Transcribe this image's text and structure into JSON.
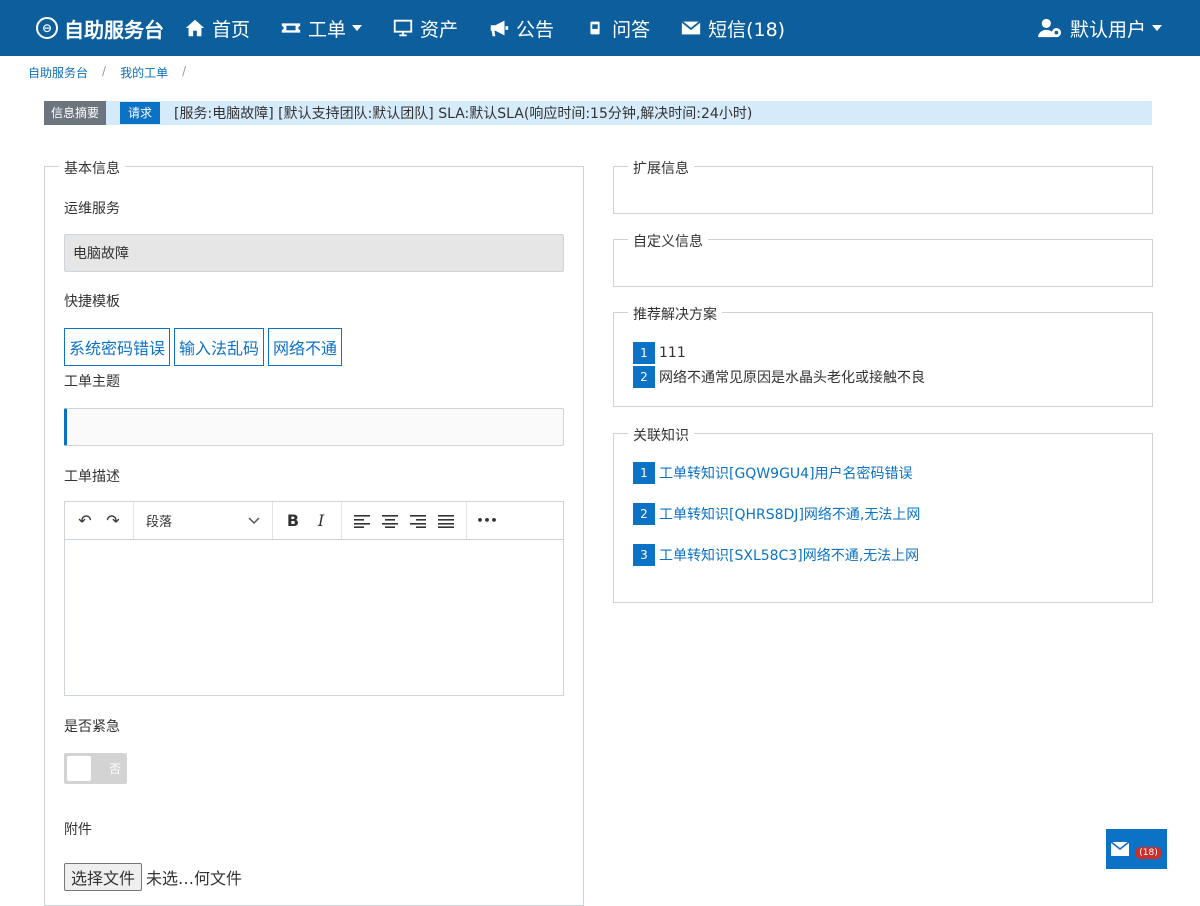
{
  "nav": {
    "brand": "自助服务台",
    "items": [
      {
        "label": "首页",
        "icon": "home-icon"
      },
      {
        "label": "工单",
        "icon": "ticket-icon",
        "dropdown": true
      },
      {
        "label": "资产",
        "icon": "monitor-icon"
      },
      {
        "label": "公告",
        "icon": "megaphone-icon"
      },
      {
        "label": "问答",
        "icon": "qa-icon"
      },
      {
        "label": "短信(18)",
        "icon": "envelope-icon"
      }
    ],
    "user": "默认用户"
  },
  "breadcrumb": {
    "items": [
      "自助服务台",
      "我的工单"
    ]
  },
  "summary": {
    "tag_summary": "信息摘要",
    "tag_type": "请求",
    "text": "[服务:电脑故障]  [默认支持团队:默认团队]  SLA:默认SLA(响应时间:15分钟,解决时间:24小时)"
  },
  "basic": {
    "legend": "基本信息",
    "service_label": "运维服务",
    "service_value": "电脑故障",
    "template_label": "快捷模板",
    "templates": [
      "系统密码错误",
      "输入法乱码",
      "网络不通"
    ],
    "subject_label": "工单主题",
    "subject_value": "",
    "desc_label": "工单描述",
    "editor": {
      "paragraph_select": "段落",
      "undo": "↶",
      "redo": "↷",
      "bold": "B",
      "italic": "I",
      "more": "•••"
    },
    "urgent_label": "是否紧急",
    "urgent_toggle_text": "否",
    "attach_label": "附件",
    "file_button": "选择文件",
    "file_status": "未选…何文件"
  },
  "extended": {
    "legend": "扩展信息"
  },
  "custom": {
    "legend": "自定义信息"
  },
  "recommend": {
    "legend": "推荐解决方案",
    "items": [
      {
        "num": "1",
        "text": "111"
      },
      {
        "num": "2",
        "text": "网络不通常见原因是水晶头老化或接触不良"
      }
    ]
  },
  "knowledge": {
    "legend": "关联知识",
    "items": [
      {
        "num": "1",
        "text": "工单转知识[GQW9GU4]用户名密码错误"
      },
      {
        "num": "2",
        "text": "工单转知识[QHRS8DJ]网络不通,无法上网"
      },
      {
        "num": "3",
        "text": "工单转知识[SXL58C3]网络不通,无法上网"
      }
    ]
  },
  "float_message": {
    "badge": "(18)",
    "icon": "envelope-icon"
  },
  "colors": {
    "navbar": "#0c5f9c",
    "accent": "#0c72c6",
    "summary_bg": "#d6ebfa",
    "tag_grey": "#6c757d"
  }
}
